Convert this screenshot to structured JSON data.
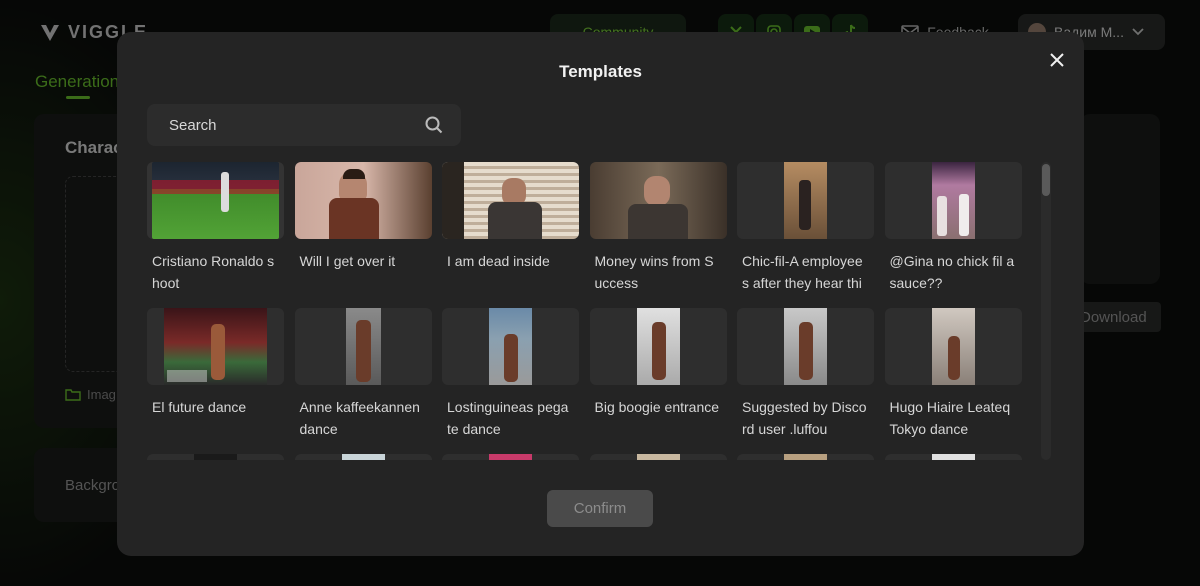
{
  "app": {
    "logo_text": "VIGGLE",
    "community_label": "Community",
    "feedback_label": "Feedback",
    "user_name": "Вадим М...",
    "generation_tab": "Generation",
    "character_label": "Charac",
    "image_label": "Imag",
    "background_label": "Backgro",
    "download_label": "Download",
    "accent_color": "#6cc52f"
  },
  "modal": {
    "title": "Templates",
    "search_placeholder": "Search",
    "confirm_label": "Confirm",
    "templates": [
      {
        "title": "Cristiano Ronaldo shoot"
      },
      {
        "title": "Will I get over it"
      },
      {
        "title": "I am dead inside"
      },
      {
        "title": "Money wins from Success"
      },
      {
        "title": "Chic-fil-A employees after they hear this..."
      },
      {
        "title": "@Gina no chick fil a sauce??"
      },
      {
        "title": "El future dance"
      },
      {
        "title": "Anne kaffeekannen dance"
      },
      {
        "title": "Lostinguineas pegate dance"
      },
      {
        "title": "Big boogie entrance"
      },
      {
        "title": "Suggested by Discord user .luffou"
      },
      {
        "title": "Hugo Hiaire Leateq Tokyo dance"
      },
      {
        "title": ""
      },
      {
        "title": ""
      },
      {
        "title": ""
      },
      {
        "title": ""
      },
      {
        "title": ""
      },
      {
        "title": ""
      }
    ]
  }
}
